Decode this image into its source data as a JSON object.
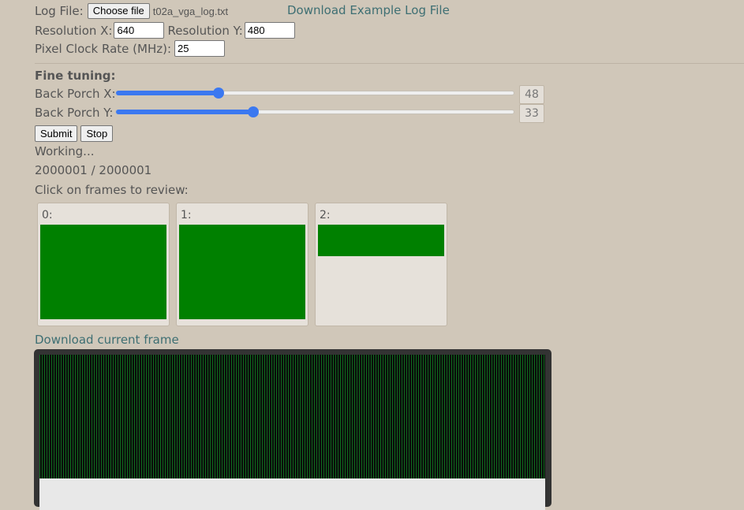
{
  "log_file": {
    "label": "Log File:",
    "button_label": "Choose file",
    "file_name": "t02a_vga_log.txt",
    "example_link": "Download Example Log File"
  },
  "resolution": {
    "x_label": "Resolution X:",
    "x_value": "640",
    "y_label": "Resolution Y:",
    "y_value": "480"
  },
  "pixel_clock": {
    "label": "Pixel Clock Rate (MHz):",
    "value": "25"
  },
  "fine_tuning": {
    "heading": "Fine tuning:",
    "back_porch_x": {
      "label": "Back Porch X:",
      "value": "48",
      "fraction": 0.25
    },
    "back_porch_y": {
      "label": "Back Porch Y:",
      "value": "33",
      "fraction": 0.34
    }
  },
  "actions": {
    "submit_label": "Submit",
    "stop_label": "Stop"
  },
  "status": {
    "text": "Working...",
    "progress": "2000001 / 2000001"
  },
  "frames": {
    "prompt": "Click on frames to review:",
    "items": [
      {
        "label": "0:",
        "fill_fraction": 1.0
      },
      {
        "label": "1:",
        "fill_fraction": 1.0
      },
      {
        "label": "2:",
        "fill_fraction": 0.33
      }
    ]
  },
  "download_frame_link": "Download current frame",
  "colors": {
    "background": "#d0c7b9",
    "link": "#3e6f73",
    "slider_accent": "#3b78f0",
    "frame_green": "#008000"
  }
}
